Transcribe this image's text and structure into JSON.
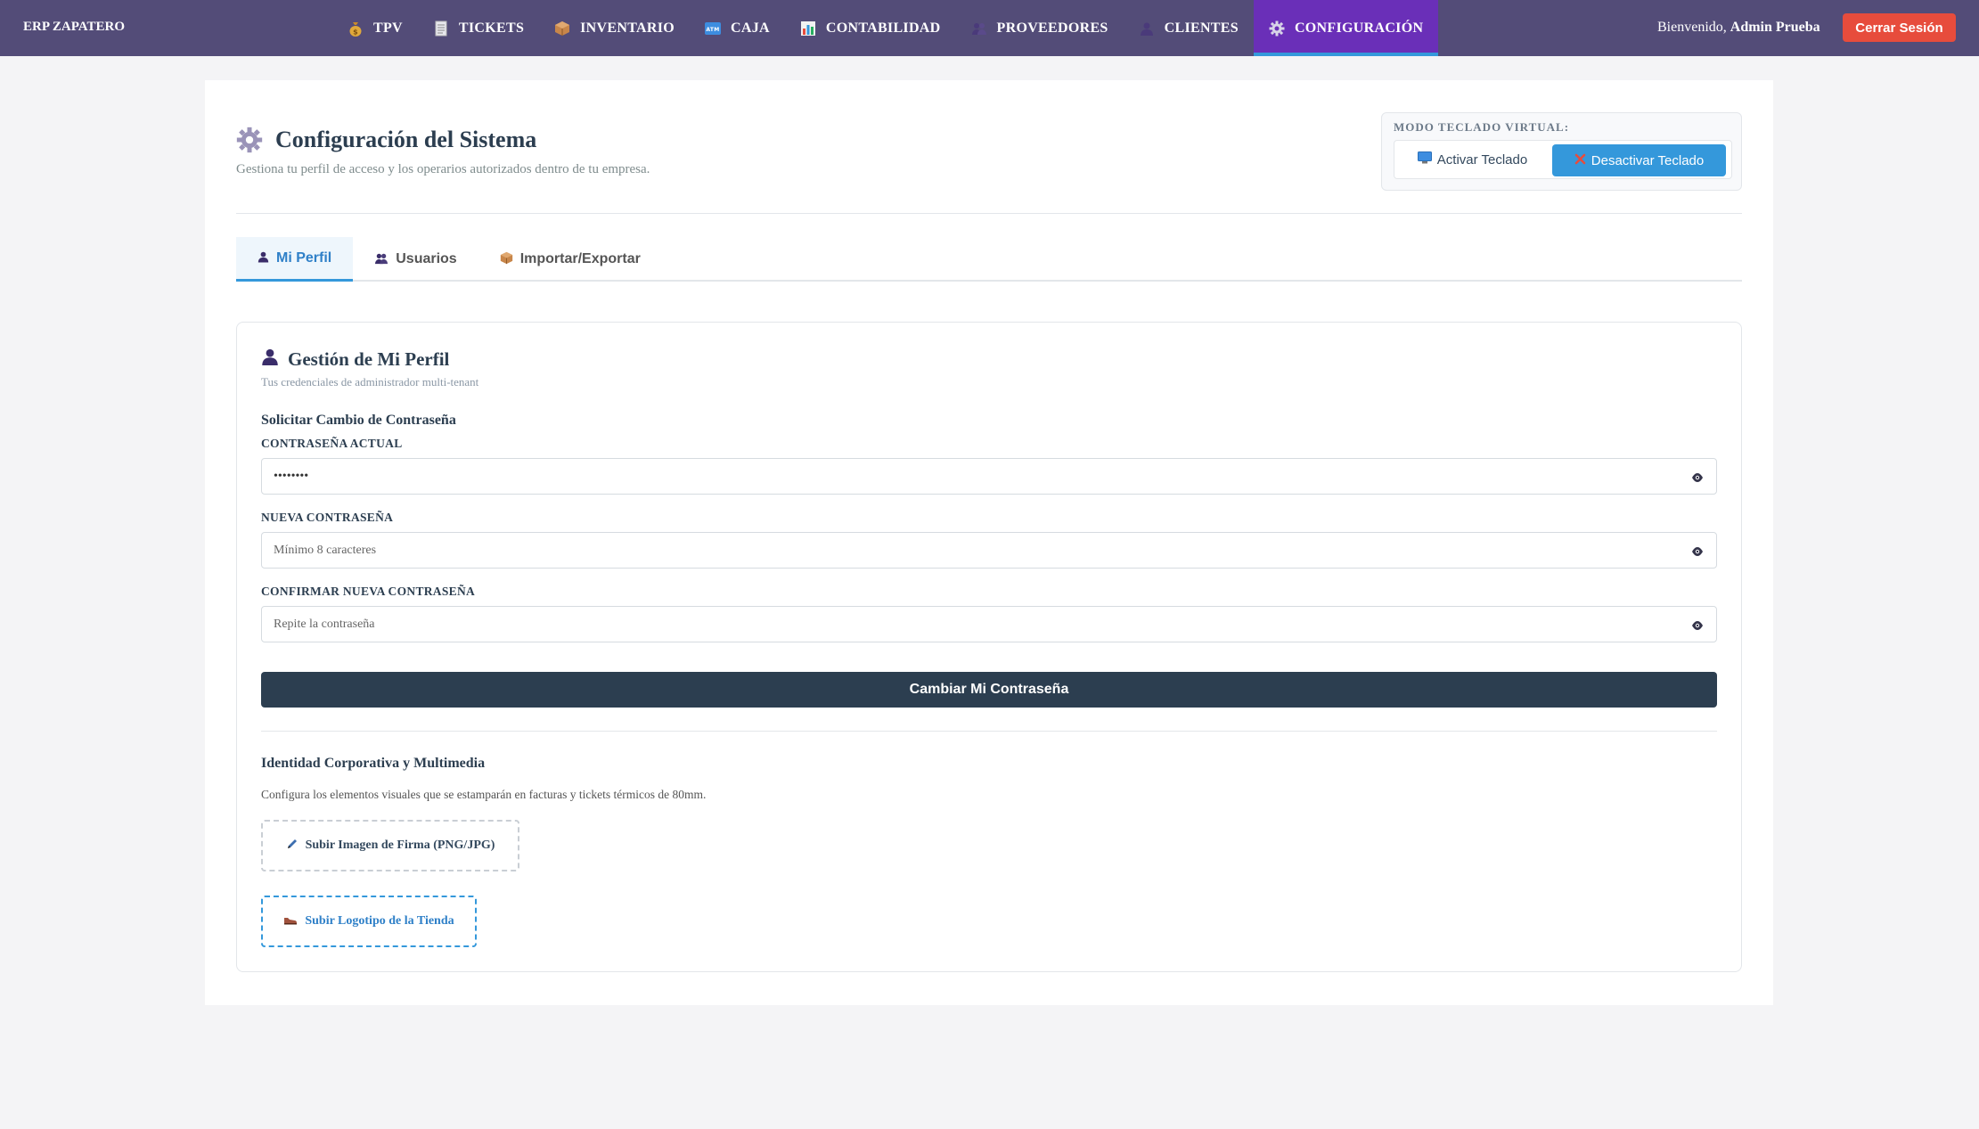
{
  "app": {
    "brand": "ERP ZAPATERO"
  },
  "nav": {
    "items": [
      {
        "label": "TPV",
        "icon": "money-bag-icon"
      },
      {
        "label": "TICKETS",
        "icon": "receipt-icon"
      },
      {
        "label": "INVENTARIO",
        "icon": "box-icon"
      },
      {
        "label": "CAJA",
        "icon": "atm-icon"
      },
      {
        "label": "CONTABILIDAD",
        "icon": "bar-chart-icon"
      },
      {
        "label": "PROVEEDORES",
        "icon": "users-icon"
      },
      {
        "label": "CLIENTES",
        "icon": "user-icon"
      },
      {
        "label": "CONFIGURACIÓN",
        "icon": "gear-icon",
        "active": true
      }
    ],
    "welcome_prefix": "Bienvenido,",
    "user_name": "Admin Prueba",
    "logout_label": "Cerrar Sesión"
  },
  "header": {
    "title": "Configuración del Sistema",
    "subtitle": "Gestiona tu perfil de acceso y los operarios autorizados dentro de tu empresa."
  },
  "keyboard": {
    "label": "MODO TECLADO VIRTUAL:",
    "activate_label": "Activar Teclado",
    "deactivate_label": "Desactivar Teclado"
  },
  "tabs": [
    {
      "label": "Mi Perfil",
      "active": true
    },
    {
      "label": "Usuarios"
    },
    {
      "label": "Importar/Exportar"
    }
  ],
  "profile": {
    "title": "Gestión de Mi Perfil",
    "subtitle": "Tus credenciales de administrador multi-tenant",
    "password_section": "Solicitar Cambio de Contraseña",
    "current_label": "CONTRASEÑA ACTUAL",
    "current_value": "••••••••",
    "new_label": "NUEVA CONTRASEÑA",
    "new_placeholder": "Mínimo 8 caracteres",
    "confirm_label": "CONFIRMAR NUEVA CONTRASEÑA",
    "confirm_placeholder": "Repite la contraseña",
    "submit_label": "Cambiar Mi Contraseña",
    "identity_section": "Identidad Corporativa y Multimedia",
    "identity_desc": "Configura los elementos visuales que se estamparán en facturas y tickets térmicos de 80mm.",
    "upload_signature_label": "Subir Imagen de Firma (PNG/JPG)",
    "upload_logo_label": "Subir Logotipo de la Tienda"
  },
  "colors": {
    "nav_bg": "#534c78",
    "nav_active": "#6a2fb8",
    "accent": "#3498db",
    "danger": "#e74c3c",
    "dark": "#2c3e50"
  }
}
